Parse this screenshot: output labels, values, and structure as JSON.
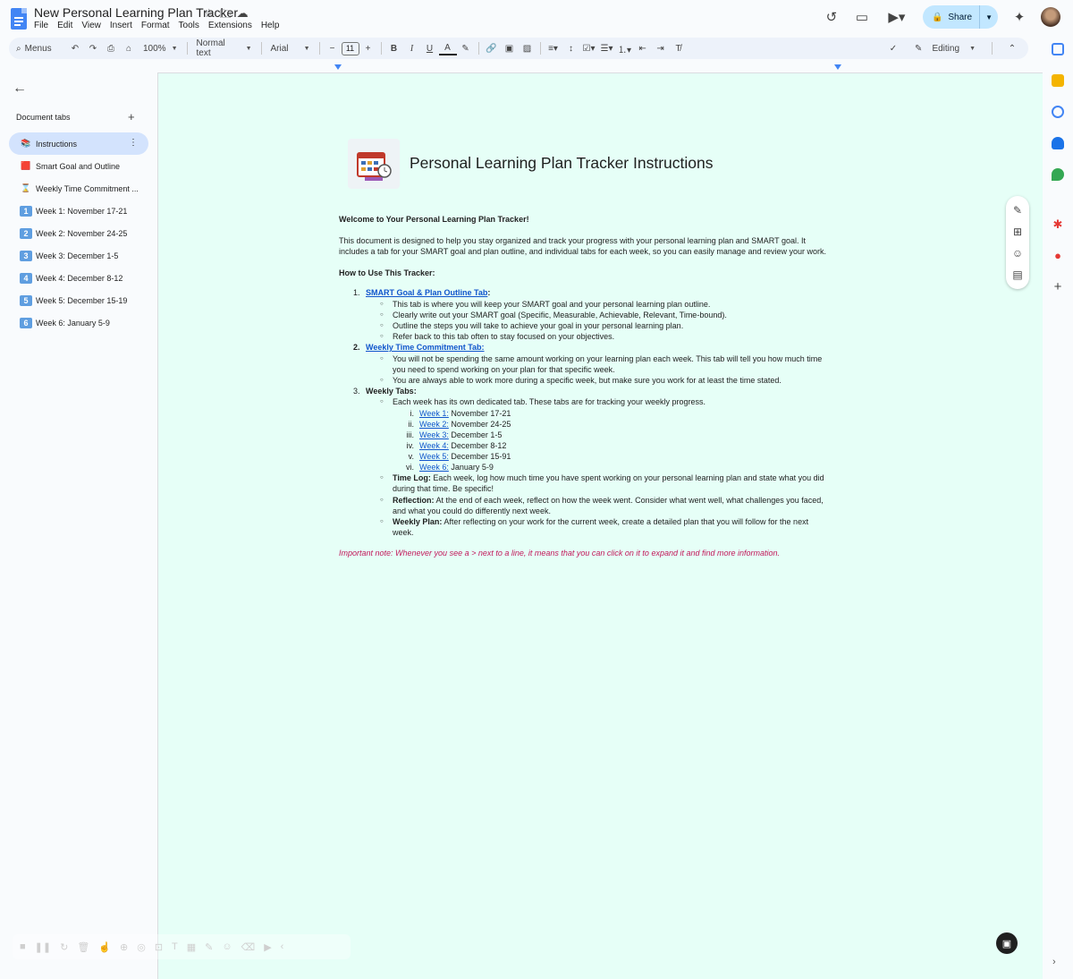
{
  "app": {
    "doc_title": "New Personal Learning Plan Tracker",
    "menu": [
      "File",
      "Edit",
      "View",
      "Insert",
      "Format",
      "Tools",
      "Extensions",
      "Help"
    ],
    "share_label": "Share",
    "brand_color": "#4285f4"
  },
  "toolbar": {
    "menus_label": "Menus",
    "zoom": "100%",
    "style": "Normal text",
    "font": "Arial",
    "font_size": "11",
    "mode": "Editing"
  },
  "sidebar": {
    "header": "Document tabs",
    "tabs": [
      {
        "label": "Instructions",
        "emoji": "📚"
      },
      {
        "label": "Smart Goal and Outline",
        "emoji": "🟥"
      },
      {
        "label": "Weekly Time Commitment ...",
        "emoji": "⌛"
      },
      {
        "label": "Week 1: November 17-21",
        "emoji": "1"
      },
      {
        "label": "Week 2: November 24-25",
        "emoji": "2"
      },
      {
        "label": "Week 3: December 1-5",
        "emoji": "3"
      },
      {
        "label": "Week 4: December 8-12",
        "emoji": "4"
      },
      {
        "label": "Week 5: December 15-19",
        "emoji": "5"
      },
      {
        "label": "Week 6: January 5-9",
        "emoji": "6"
      }
    ]
  },
  "doc": {
    "heading": "Personal Learning Plan Tracker Instructions",
    "welcome": "Welcome to Your Personal Learning Plan Tracker!",
    "intro_1": "This document is designed to help you stay organized and track your progress with your personal learning plan and SMART goal. It",
    "intro_2": "includes a tab for your SMART goal and plan outline, and individual tabs for each week, so you can easily manage and review your work.",
    "how_to": "How to Use This Tracker:",
    "item1_num": "1.",
    "item1_link": "SMART Goal & Plan Outline Tab",
    "item1_colon": ":",
    "item1_bullets": [
      "This tab is where you will keep your SMART goal and your personal learning plan outline.",
      "Clearly write out your SMART goal (Specific, Measurable, Achievable, Relevant, Time-bound).",
      "Outline the steps you will take to achieve your goal in your personal learning plan.",
      "Refer back to this tab often to stay focused on your objectives."
    ],
    "item2_num": "2.",
    "item2_link": "Weekly Time Commitment Tab:",
    "item2_bullet1_a": "You will not be spending the same amount working on your learning plan each week.  This tab will tell you how much time",
    "item2_bullet1_b": "you need to spend working on your plan for that specific week.",
    "item2_bullet2": "You are always able to work more during a specific week, but make sure you work for at least the time stated.",
    "item3_num": "3.",
    "item3_label": "Weekly Tabs:",
    "item3_bullet1": "Each week has its own dedicated tab. These tabs are for tracking your weekly progress.",
    "weeks": [
      {
        "num": "i.",
        "link": "Week 1:",
        "text": " November 17-21"
      },
      {
        "num": "ii.",
        "link": "Week 2:",
        "text": " November 24-25"
      },
      {
        "num": "iii.",
        "link": "Week 3:",
        "text": " December 1-5"
      },
      {
        "num": "iv.",
        "link": "Week 4:",
        "text": " December 8-12"
      },
      {
        "num": "v.",
        "link": "Week 5:",
        "text": " December 15-91"
      },
      {
        "num": "vi.",
        "link": "Week 6:",
        "text": " January 5-9"
      }
    ],
    "timelog_label": "Time Log:",
    "timelog_a": " Each week, log how much time you have spent working on your personal learning plan and state what you did",
    "timelog_b": "during that time. Be specific!",
    "reflection_label": "Reflection:",
    "reflection_a": " At the end of each week, reflect on how the week went. Consider what went well, what challenges you faced,",
    "reflection_b": "and what you could do differently next week.",
    "weeklyplan_label": "Weekly Plan:",
    "weeklyplan_a": " After reflecting on your work for the current week, create a detailed plan that you will follow for the next",
    "weeklyplan_b": "week.",
    "note": "Important note:  Whenever you see a > next to a line, it means that you can click on it to expand it and find more information.",
    "note_color": "#c2185b",
    "page_bg": "#e6fff7"
  }
}
